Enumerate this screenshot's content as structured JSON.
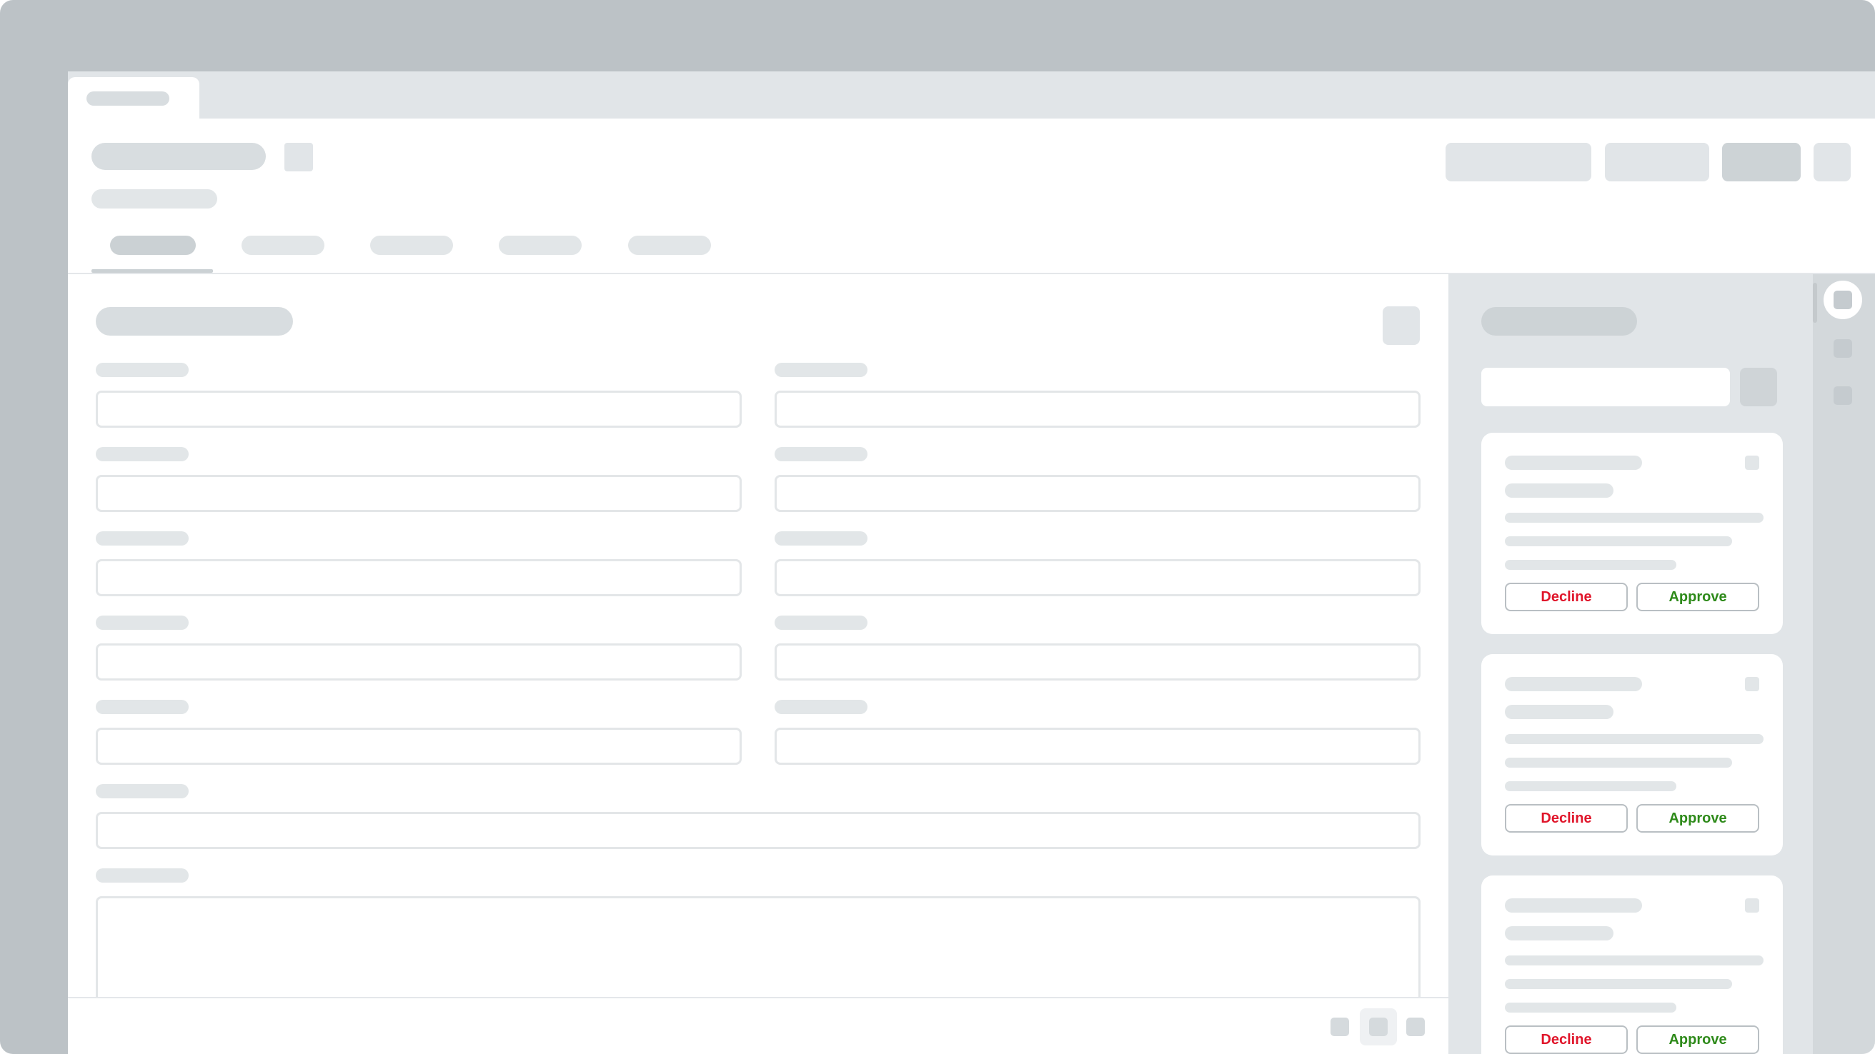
{
  "colors": {
    "frame_bg": "#bcc2c6",
    "skeleton": "#d8dde0",
    "decline_text": "#e0162b",
    "approve_text": "#2e8a1a"
  },
  "requests": {
    "decline_label": "Decline",
    "approve_label": "Approve",
    "cards": [
      {
        "decline": "Decline",
        "approve": "Approve"
      },
      {
        "decline": "Decline",
        "approve": "Approve"
      },
      {
        "decline": "Decline",
        "approve": "Approve"
      }
    ]
  }
}
